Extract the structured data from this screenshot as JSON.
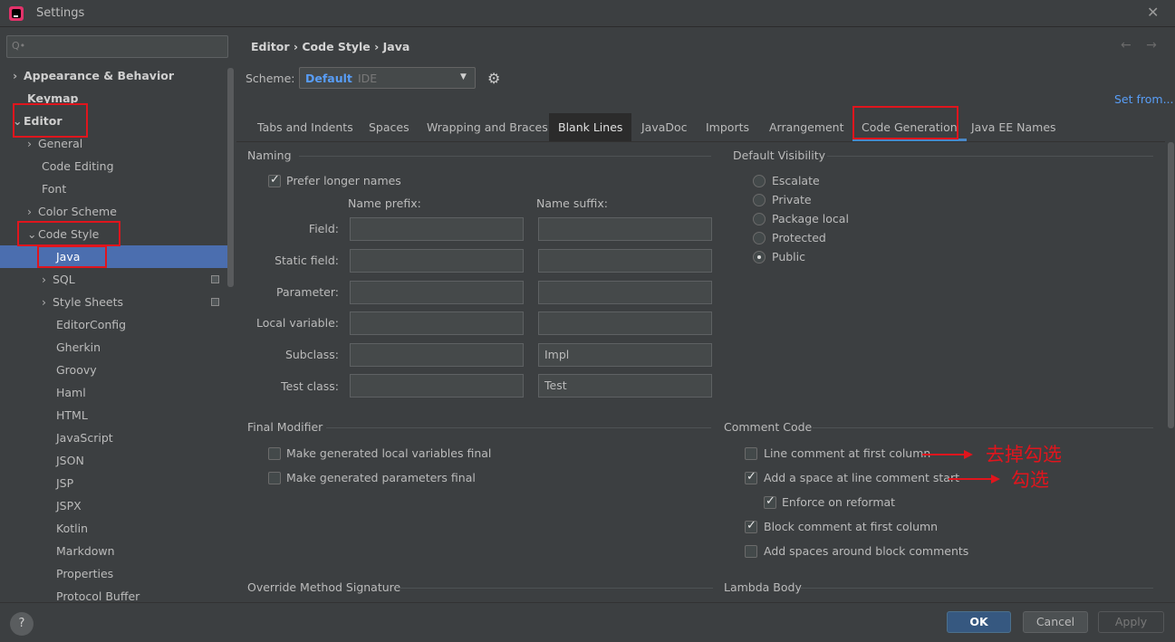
{
  "window": {
    "title": "Settings",
    "close": "✕"
  },
  "sidebar": {
    "search_glyph": "Q•",
    "items": [
      {
        "label": "Appearance & Behavior",
        "chev": "›"
      },
      {
        "label": "Keymap"
      },
      {
        "label": "Editor",
        "chev": "⌄"
      },
      {
        "label": "General",
        "chev": "›"
      },
      {
        "label": "Code Editing"
      },
      {
        "label": "Font"
      },
      {
        "label": "Color Scheme",
        "chev": "›"
      },
      {
        "label": "Code Style",
        "chev": "⌄"
      },
      {
        "label": "Java"
      },
      {
        "label": "SQL",
        "chev": "›"
      },
      {
        "label": "Style Sheets",
        "chev": "›"
      },
      {
        "label": "EditorConfig"
      },
      {
        "label": "Gherkin"
      },
      {
        "label": "Groovy"
      },
      {
        "label": "Haml"
      },
      {
        "label": "HTML"
      },
      {
        "label": "JavaScript"
      },
      {
        "label": "JSON"
      },
      {
        "label": "JSP"
      },
      {
        "label": "JSPX"
      },
      {
        "label": "Kotlin"
      },
      {
        "label": "Markdown"
      },
      {
        "label": "Properties"
      },
      {
        "label": "Protocol Buffer"
      }
    ]
  },
  "header": {
    "breadcrumb": "Editor › Code Style › Java",
    "nav_arrows": "← →",
    "scheme_label": "Scheme:",
    "scheme_name": "Default",
    "scheme_type": "IDE",
    "set_from": "Set from..."
  },
  "tabs": [
    "Tabs and Indents",
    "Spaces",
    "Wrapping and Braces",
    "Blank Lines",
    "JavaDoc",
    "Imports",
    "Arrangement",
    "Code Generation",
    "Java EE Names"
  ],
  "naming": {
    "title": "Naming",
    "prefer_longer": "Prefer longer names",
    "prefix_header": "Name prefix:",
    "suffix_header": "Name suffix:",
    "rows": [
      {
        "label": "Field:",
        "prefix": "",
        "suffix": ""
      },
      {
        "label": "Static field:",
        "prefix": "",
        "suffix": ""
      },
      {
        "label": "Parameter:",
        "prefix": "",
        "suffix": ""
      },
      {
        "label": "Local variable:",
        "prefix": "",
        "suffix": ""
      },
      {
        "label": "Subclass:",
        "prefix": "",
        "suffix": "Impl"
      },
      {
        "label": "Test class:",
        "prefix": "",
        "suffix": "Test"
      }
    ]
  },
  "visibility": {
    "title": "Default Visibility",
    "options": [
      "Escalate",
      "Private",
      "Package local",
      "Protected",
      "Public"
    ],
    "selected": "Public"
  },
  "final_modifier": {
    "title": "Final Modifier",
    "local_vars": "Make generated local variables final",
    "params": "Make generated parameters final"
  },
  "comment_code": {
    "title": "Comment Code",
    "line_first": "Line comment at first column",
    "add_space": "Add a space at line comment start",
    "enforce": "Enforce on reformat",
    "block_first": "Block comment at first column",
    "block_spaces": "Add spaces around block comments"
  },
  "annotations": {
    "uncheck": "去掉勾选",
    "check": "勾选"
  },
  "lower_sections": {
    "override": "Override Method Signature",
    "lambda": "Lambda Body"
  },
  "footer": {
    "help": "?",
    "ok": "OK",
    "cancel": "Cancel",
    "apply": "Apply"
  },
  "colors": {
    "accent": "#4b6eaf",
    "annotation": "#e0151d",
    "link": "#589df6"
  }
}
